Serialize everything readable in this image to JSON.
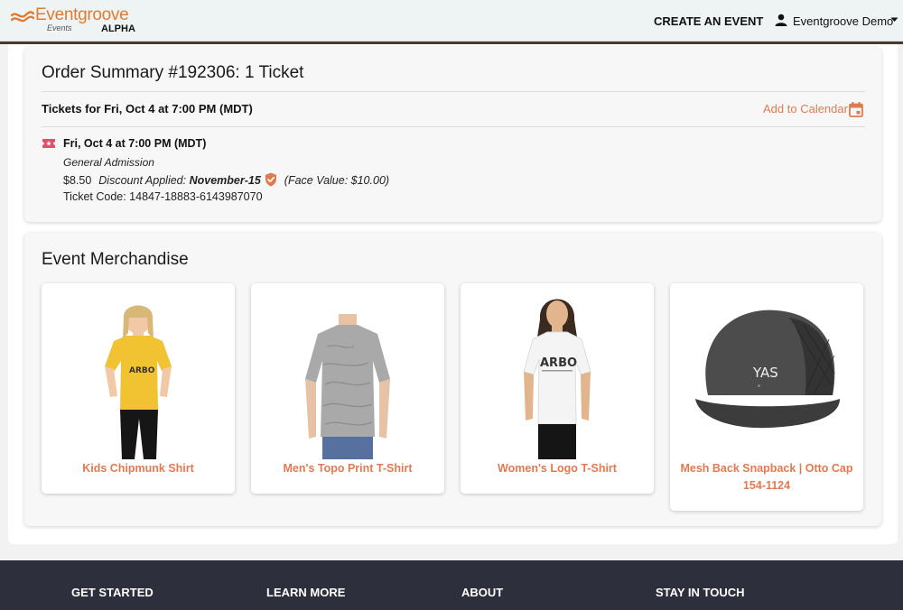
{
  "header": {
    "logo_text": "Eventgroove",
    "logo_sub": "Events",
    "logo_badge": "ALPHA",
    "create_event": "CREATE AN EVENT",
    "user_name": "Eventgroove Demo",
    "icons": [
      "wave-logo-icon",
      "user-icon",
      "caret-down-icon"
    ]
  },
  "order": {
    "title": "Order Summary #192306: 1 Ticket",
    "tickets_for": "Tickets for Fri, Oct 4 at 7:00 PM (MDT)",
    "add_to_calendar": "Add to Calendar",
    "ticket": {
      "date": "Fri, Oct 4 at 7:00 PM (MDT)",
      "type": "General Admission",
      "price": "$8.50",
      "discount_label": "Discount Applied: ",
      "discount_code": "November-15",
      "face_value": "(Face Value: $10.00)",
      "code": "Ticket Code: 14847-18883-6143987070"
    },
    "colors": {
      "accent": "#e07b50",
      "ticket_icon": "#e0506a"
    }
  },
  "merch": {
    "title": "Event Merchandise",
    "products": [
      {
        "name": "Kids Chipmunk Shirt",
        "shirt_color": "#f1c232",
        "logo": "ARBO"
      },
      {
        "name": "Men's Topo Print T-Shirt",
        "shirt_color": "#a9a9a9",
        "logo": ""
      },
      {
        "name": "Women's Logo T-Shirt",
        "shirt_color": "#f4f4f4",
        "logo": "ARBO"
      },
      {
        "name": "Mesh Back Snapback | Otto Cap 154-1124",
        "shirt_color": "#555555",
        "logo": "YAS"
      }
    ]
  },
  "footer": {
    "columns": [
      "GET STARTED",
      "LEARN MORE",
      "ABOUT",
      "STAY IN TOUCH"
    ]
  }
}
